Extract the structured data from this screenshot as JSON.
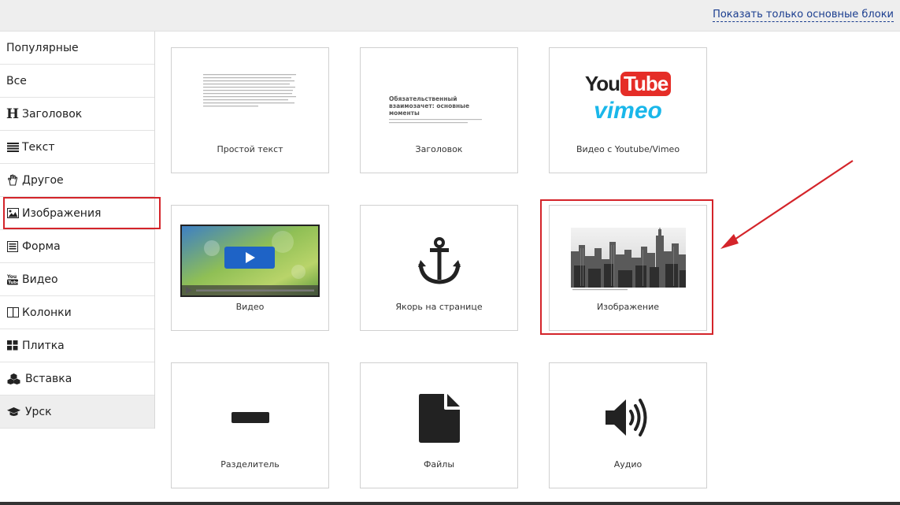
{
  "topbar": {
    "toggle_link": "Показать только основные блоки"
  },
  "sidebar": {
    "items": [
      {
        "label": "Популярные",
        "icon": "none"
      },
      {
        "label": "Все",
        "icon": "none"
      },
      {
        "label": "Заголовок",
        "icon": "heading-icon"
      },
      {
        "label": "Текст",
        "icon": "text-lines-icon"
      },
      {
        "label": "Другое",
        "icon": "hand-icon"
      },
      {
        "label": "Изображения",
        "icon": "image-icon"
      },
      {
        "label": "Форма",
        "icon": "form-icon"
      },
      {
        "label": "Видео",
        "icon": "youtube-icon"
      },
      {
        "label": "Колонки",
        "icon": "columns-icon"
      },
      {
        "label": "Плитка",
        "icon": "tiles-icon"
      },
      {
        "label": "Вставка",
        "icon": "cubes-icon"
      },
      {
        "label": "Урск",
        "icon": "graduation-cap-icon"
      }
    ],
    "active_index": 11,
    "highlighted_index": 5
  },
  "tiles": [
    {
      "caption": "Простой текст",
      "icon": "text-preview"
    },
    {
      "caption": "Заголовок",
      "icon": "heading-preview",
      "preview_title": "Обязательственный взаимозачет: основные моменты"
    },
    {
      "caption": "Видео с Youtube/Vimeo",
      "icon": "youtube-vimeo-logos",
      "logo_youtube_a": "You",
      "logo_youtube_b": "Tube",
      "logo_vimeo": "vimeo"
    },
    {
      "caption": "Видео",
      "icon": "video-player-preview"
    },
    {
      "caption": "Якорь на странице",
      "icon": "anchor-icon"
    },
    {
      "caption": "Изображение",
      "icon": "city-photo-preview"
    },
    {
      "caption": "Разделитель",
      "icon": "divider-icon"
    },
    {
      "caption": "Файлы",
      "icon": "file-icon"
    },
    {
      "caption": "Аудио",
      "icon": "volume-icon"
    }
  ],
  "colors": {
    "highlight": "#d4242a",
    "link": "#1a3d8f",
    "youtube_red": "#e52d27",
    "vimeo_blue": "#1ab7ea"
  }
}
